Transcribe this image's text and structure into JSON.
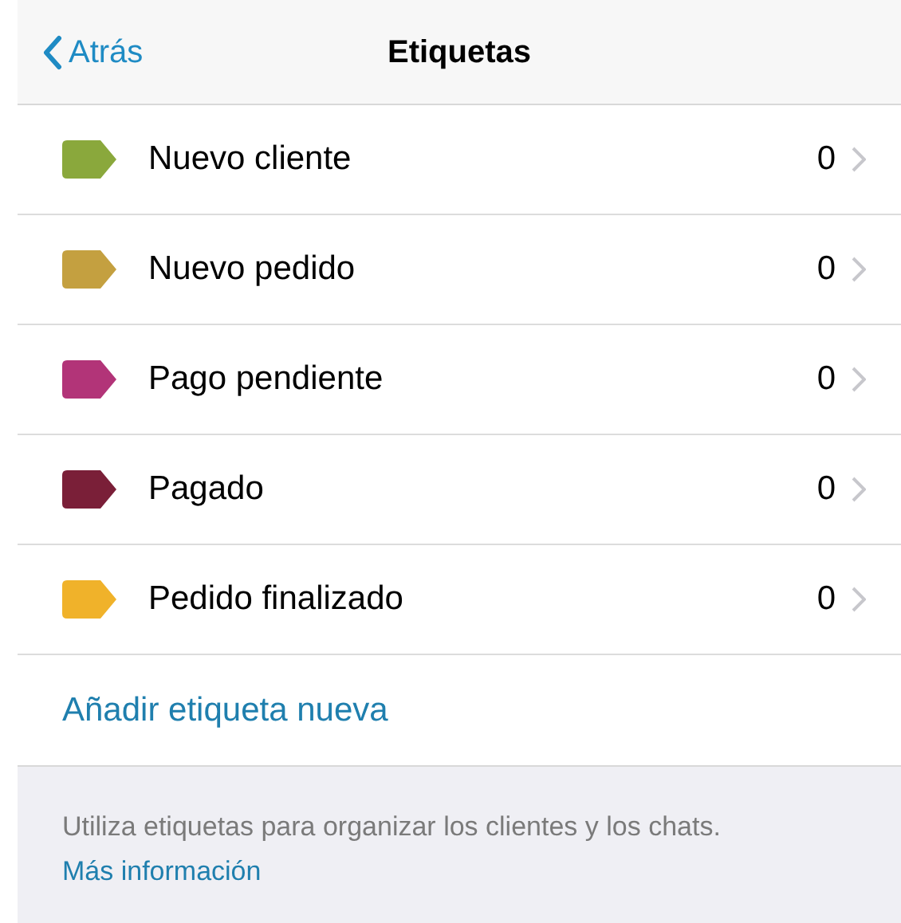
{
  "nav": {
    "back": "Atrás",
    "title": "Etiquetas"
  },
  "labels": [
    {
      "name": "Nuevo cliente",
      "count": "0",
      "color": "#8aa83c"
    },
    {
      "name": "Nuevo pedido",
      "count": "0",
      "color": "#c4a040"
    },
    {
      "name": "Pago pendiente",
      "count": "0",
      "color": "#b23478"
    },
    {
      "name": "Pagado",
      "count": "0",
      "color": "#7a1f38"
    },
    {
      "name": "Pedido finalizado",
      "count": "0",
      "color": "#f0b22a"
    }
  ],
  "add_label": "Añadir etiqueta nueva",
  "footer": {
    "text": "Utiliza etiquetas para organizar los clientes y los chats.",
    "link": "Más información"
  }
}
